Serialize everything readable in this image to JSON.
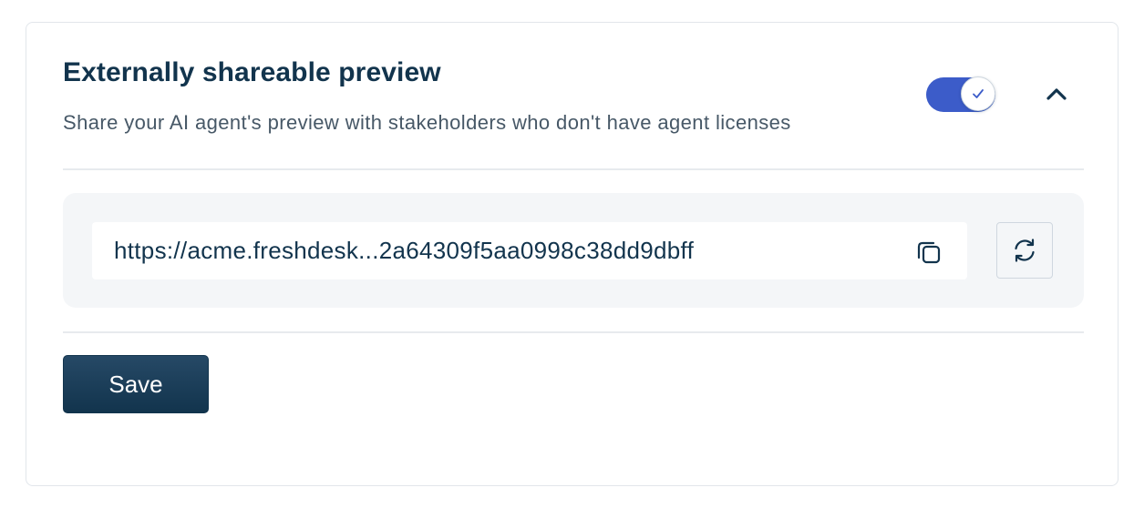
{
  "section": {
    "title": "Externally shareable preview",
    "subtitle": "Share your AI agent's preview with stakeholders who don't have agent licenses",
    "toggle": {
      "enabled": true,
      "knob_icon": "check-icon"
    },
    "collapse_icon": "chevron-up-icon"
  },
  "share_link": {
    "url_display": "https://acme.freshdesk...2a64309f5aa0998c38dd9dbff",
    "copy_icon": "copy-icon",
    "refresh_icon": "refresh-icon"
  },
  "actions": {
    "save_label": "Save"
  },
  "colors": {
    "accent": "#3c5cc9",
    "primary_text": "#12344d",
    "secondary_text": "#475867",
    "button_bg": "#1e3d58",
    "panel_bg": "#f4f6f8",
    "border": "#e2e6eb"
  }
}
